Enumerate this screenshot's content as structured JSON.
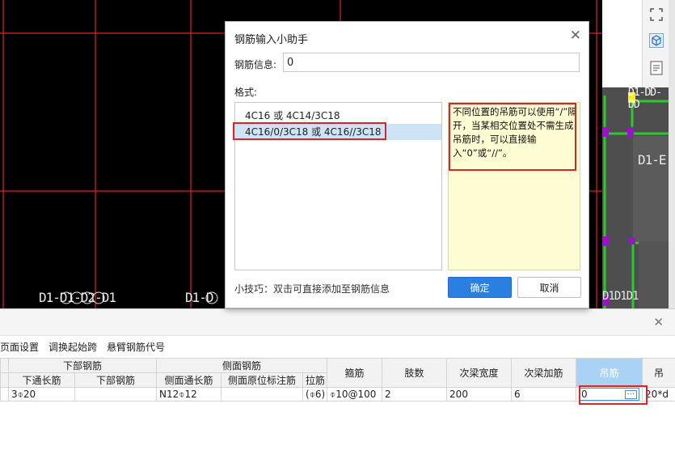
{
  "dialog": {
    "title": "钢筋输入小助手",
    "info_label": "钢筋信息:",
    "info_value": "0",
    "format_label": "格式:",
    "formats": [
      {
        "text": "4C16 或 4C14/3C18"
      },
      {
        "text": "4C16/0/3C18 或 4C16//3C18"
      }
    ],
    "tip": "不同位置的吊筋可以使用“/”隔开，当某相交位置处不需生成吊筋时，可以直接输入“0”或“//”。",
    "hint": "小技巧：双击可直接添加至钢筋信息",
    "ok_label": "确定",
    "cancel_label": "取消"
  },
  "cad": {
    "labels": [
      "D1-D1-D2-D1",
      "D1-D",
      "D1-E",
      "D1D1D1",
      "D1-DD-DD"
    ],
    "colors": {
      "background": "#000000",
      "grid": "#e0202a",
      "beam": "#2ec82e",
      "node": "#9b12c9"
    }
  },
  "panel": {
    "toolbar": [
      "页面设置",
      "调换起始跨",
      "悬臂钢筋代号"
    ],
    "group_headers": {
      "bottom": "下部钢筋",
      "side": "侧面钢筋"
    },
    "columns": [
      "下通长筋",
      "下部钢筋",
      "侧面通长筋",
      "侧面原位标注筋",
      "拉筋",
      "箍筋",
      "肢数",
      "次梁宽度",
      "次梁加筋",
      "吊筋",
      "吊"
    ],
    "row": {
      "bottom_through": "3⌽20",
      "bottom_extra": "",
      "side_through": "N12⌽12",
      "side_marked": "",
      "tie": "(⌽6)",
      "stirrup": "⌽10@100",
      "legs": "2",
      "sec_beam_width": "200",
      "sec_beam_bars": "6",
      "hanger": "0",
      "extra": "20*d"
    }
  }
}
